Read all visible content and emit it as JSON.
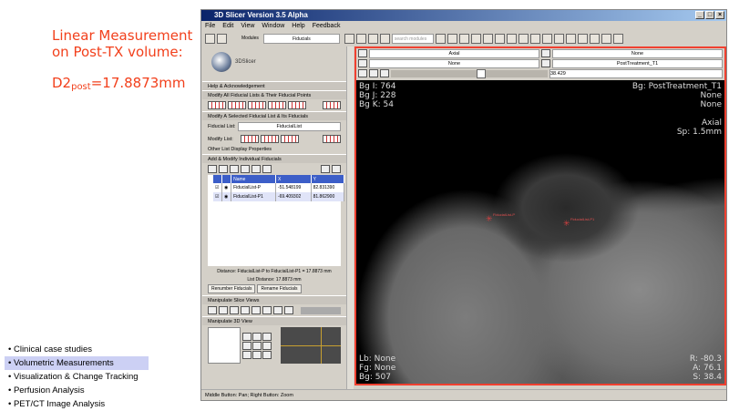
{
  "slide": {
    "title_line1": "Linear Measurement",
    "title_line2": "on Post-TX volume:",
    "d2_prefix": "D2",
    "d2_sub": "post",
    "d2_value": "=17.8873mm",
    "bullets": [
      "Clinical case studies",
      "Volumetric Measurements",
      "Visualization & Change Tracking",
      "Perfusion Analysis",
      "PET/CT Image Analysis"
    ],
    "selected_bullet": 1
  },
  "window": {
    "title": "3D Slicer Version 3.5 Alpha",
    "menu": [
      "File",
      "Edit",
      "View",
      "Window",
      "Help",
      "Feedback"
    ],
    "modules_label": "Modules",
    "module": "Fiducials",
    "search_placeholder": "search modules",
    "logo": "3DSlicer"
  },
  "panel": {
    "help": "Help & Acknowledgement",
    "modify_all": "Modify All Fiducial Lists & Their Fiducial Points",
    "modify_selected": "Modify A Selected Fiducial List & Its Fiducials",
    "list_label": "Fiducial List:",
    "list_value": "FiducialList",
    "modify_list": "Modify List:",
    "other_props": "Other List Display Properties",
    "add_modify": "Add & Modify Individual Fiducials",
    "columns": [
      "",
      "",
      "Name",
      "X",
      "Y"
    ],
    "rows": [
      {
        "name": "FiducialList-P",
        "x": "-51.548199",
        "y": "82.831390"
      },
      {
        "name": "FiducialList-P1",
        "x": "-69.409302",
        "y": "81.862900"
      }
    ],
    "distance": "Distance: FiducialList-P to FiducialList-P1 = 17.8873 mm",
    "list_distance": "List Distance: 17.8873 mm",
    "renumber": "Renumber Fiducials",
    "rename": "Rename Fiducials",
    "slice_views": "Manipulate Slice Views",
    "view3d": "Manipulate 3D View"
  },
  "viewer": {
    "orientation": "Axial",
    "fg": "None",
    "lb": "None",
    "bg": "PostTreatment_T1",
    "slice_value": "38.429",
    "slider_fraction": 0.58,
    "tl": [
      "Bg I: 764",
      "Bg J: 228",
      "Bg K: 54"
    ],
    "tr": [
      "Bg: PostTreatment_T1",
      "None",
      "None",
      "",
      "Axial",
      "Sp: 1.5mm"
    ],
    "bl": [
      "Lb: None",
      "Fg: None",
      "Bg: 507"
    ],
    "br": [
      "R: -80.3",
      "A: 76.1",
      "S: 38.4"
    ],
    "fiducials": [
      "FiducialList-P",
      "FiducialList-P1"
    ]
  },
  "status": "Middle Button: Pan; Right Button: Zoom",
  "colors": {
    "accent": "#f2401c",
    "selection": "#3c5ec8",
    "viewer_border": "#f04030"
  }
}
